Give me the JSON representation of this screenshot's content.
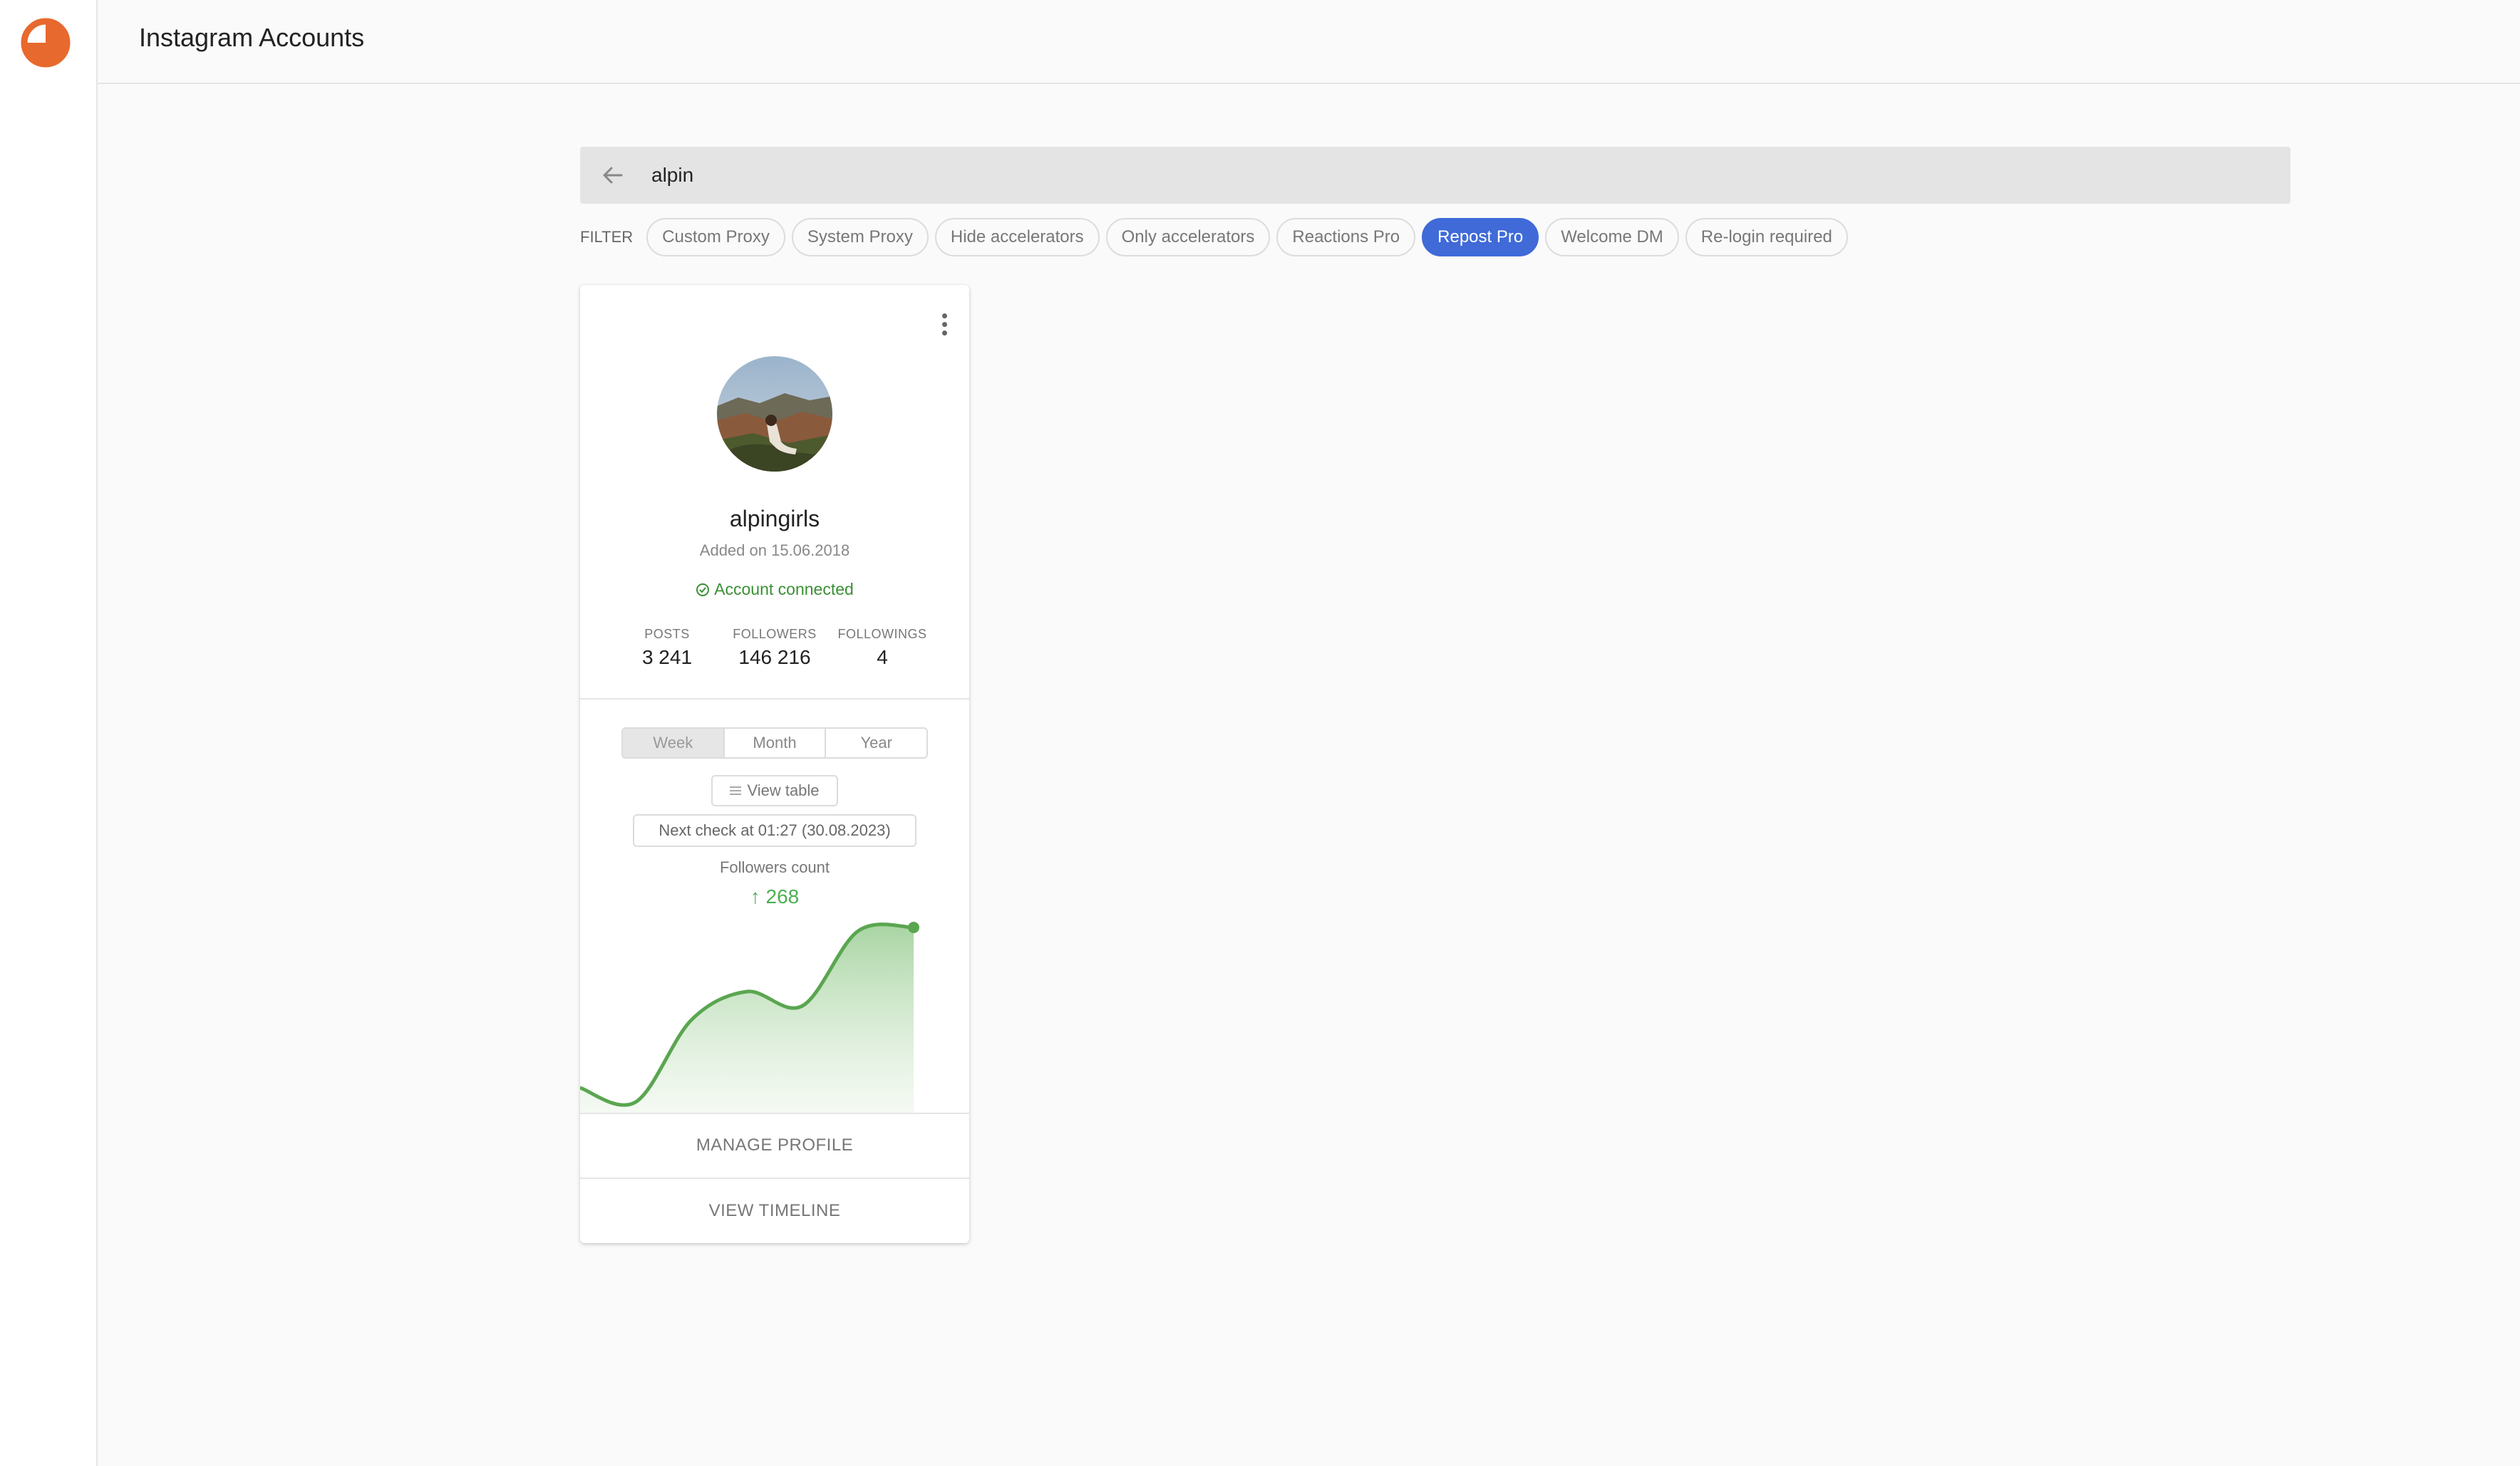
{
  "header": {
    "title": "Instagram Accounts"
  },
  "search": {
    "value": "alpin"
  },
  "filters": {
    "label": "FILTER",
    "chips": [
      {
        "label": "Custom Proxy",
        "active": false
      },
      {
        "label": "System Proxy",
        "active": false
      },
      {
        "label": "Hide accelerators",
        "active": false
      },
      {
        "label": "Only accelerators",
        "active": false
      },
      {
        "label": "Reactions Pro",
        "active": false
      },
      {
        "label": "Repost Pro",
        "active": true
      },
      {
        "label": "Welcome DM",
        "active": false
      },
      {
        "label": "Re-login required",
        "active": false
      }
    ]
  },
  "account": {
    "username": "alpingirls",
    "added": "Added on 15.06.2018",
    "status": "Account connected",
    "stats": {
      "posts_label": "POSTS",
      "posts": "3 241",
      "followers_label": "FOLLOWERS",
      "followers": "146 216",
      "followings_label": "FOLLOWINGS",
      "followings": "4"
    },
    "periods": [
      "Week",
      "Month",
      "Year"
    ],
    "selected_period": "Week",
    "view_table": "View table",
    "next_check": "Next check at 01:27 (30.08.2023)",
    "followers_count_label": "Followers count",
    "followers_delta": "268",
    "manage_profile": "MANAGE PROFILE",
    "view_timeline": "VIEW TIMELINE"
  },
  "colors": {
    "accent": "#3f6ad8",
    "brand": "#e8692d",
    "success": "#3a8f35",
    "chart_line": "#5aa650"
  },
  "icons": [
    "logo-icon",
    "back-arrow-icon",
    "more-vert-icon",
    "check-circle-icon",
    "list-icon",
    "arrow-up-icon"
  ],
  "chart_data": {
    "type": "area",
    "title": "Followers count",
    "series": [
      {
        "values": [
          0.1,
          0.02,
          0.48,
          0.64,
          0.56,
          0.98,
          1.0
        ]
      }
    ]
  }
}
